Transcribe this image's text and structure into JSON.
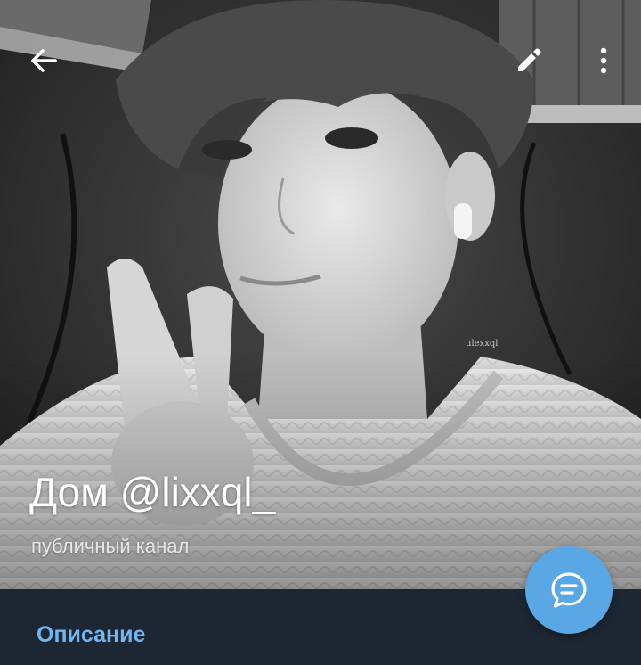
{
  "header": {
    "back_icon": "arrow-left-icon",
    "edit_icon": "pencil-icon",
    "more_icon": "more-vertical-icon"
  },
  "profile": {
    "title": "Дом @lixxql_",
    "subtitle": "публичный канал",
    "watermark": "ulexxql"
  },
  "fab": {
    "icon": "chat-bubble-icon",
    "color": "#5aa7e6"
  },
  "section": {
    "label": "Описание"
  },
  "colors": {
    "panel": "#1d2733",
    "accent": "#71b6f1"
  }
}
